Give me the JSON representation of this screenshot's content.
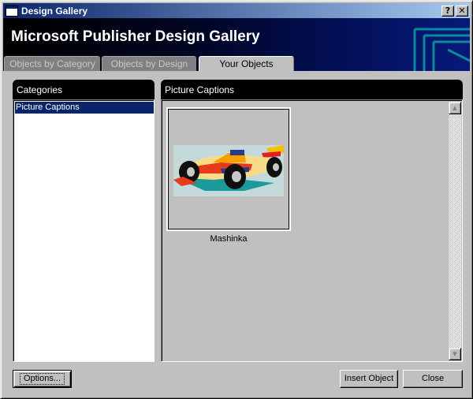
{
  "window": {
    "title": "Design Gallery"
  },
  "titlebar_buttons": {
    "help": "?",
    "close": "✕"
  },
  "banner": {
    "title": "Microsoft Publisher Design Gallery"
  },
  "tabs": [
    {
      "label": "Objects by Category"
    },
    {
      "label": "Objects by Design"
    },
    {
      "label": "Your Objects"
    }
  ],
  "categories": {
    "header": "Categories",
    "items": [
      {
        "label": "Picture Captions"
      }
    ]
  },
  "gallery": {
    "header": "Picture Captions",
    "items": [
      {
        "label": "Mashinka"
      }
    ]
  },
  "buttons": {
    "options": "Options...",
    "insert": "Insert Object",
    "close": "Close"
  },
  "colors": {
    "title_bar_start": "#0a246a",
    "title_bar_end": "#a6caf0",
    "selection": "#0a246a",
    "face": "#c0c0c0"
  }
}
